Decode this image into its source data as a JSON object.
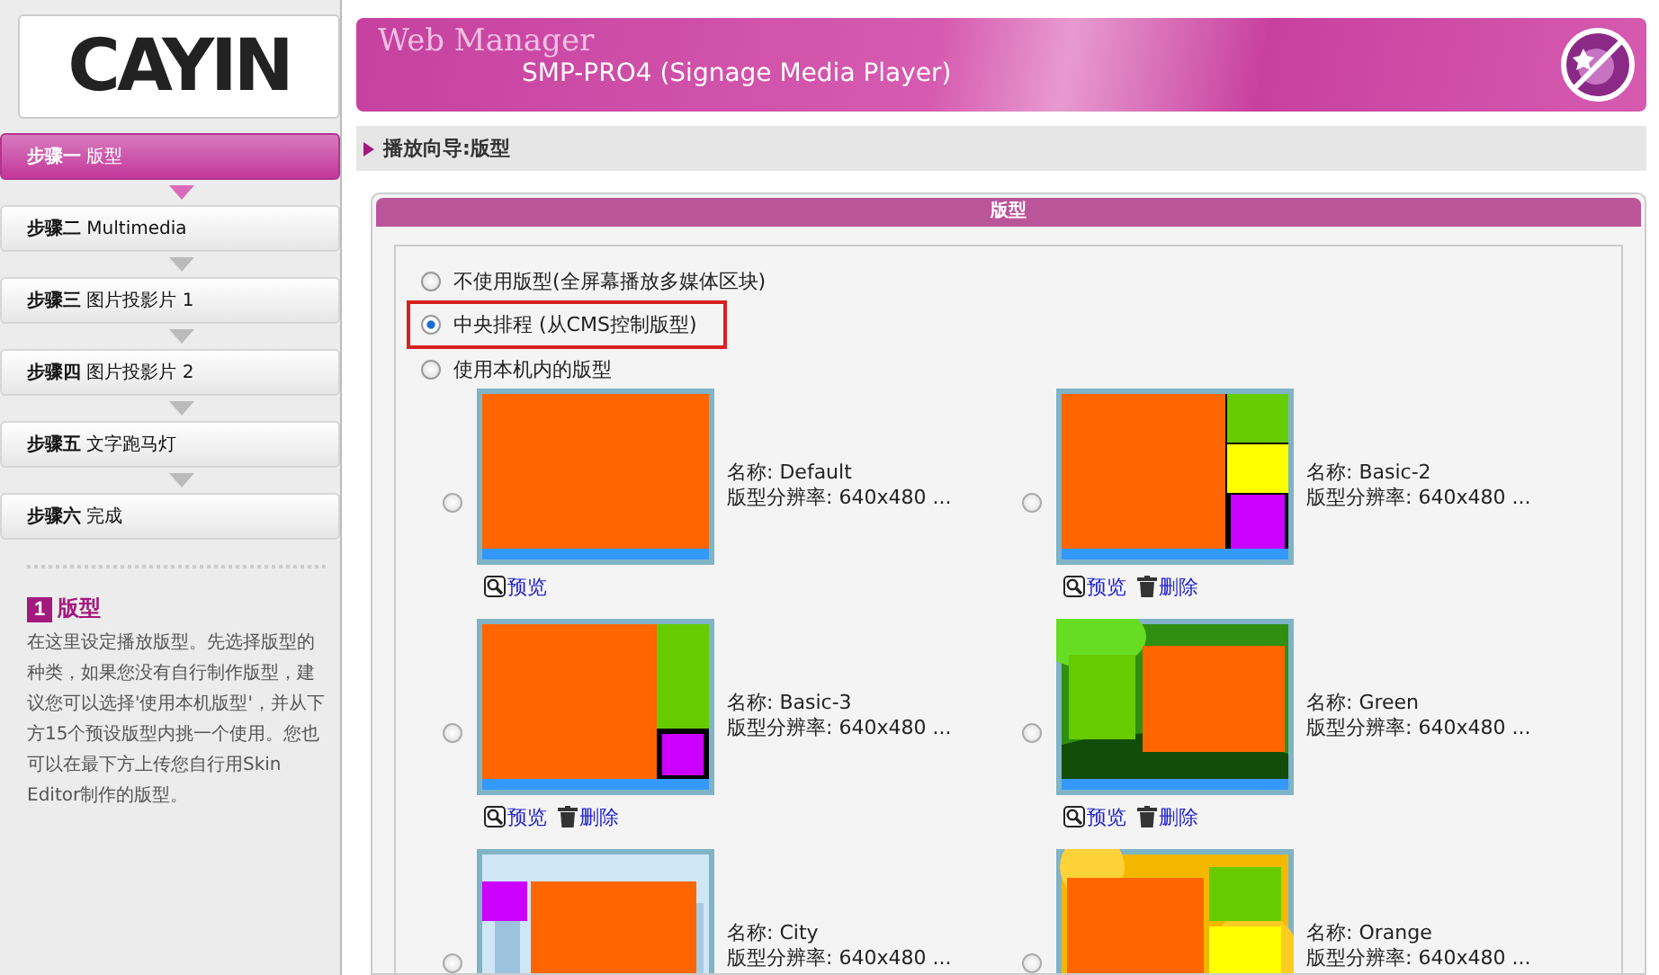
{
  "logo": "CAYIN",
  "header": {
    "title": "Web Manager",
    "subtitle": "SMP-PRO4 (Signage Media Player)"
  },
  "steps": [
    {
      "label": "**步骤一** 版型",
      "selected": true
    },
    {
      "label": "**步骤二** Multimedia",
      "selected": false
    },
    {
      "label": "**步骤三** 图片投影片 1",
      "selected": false
    },
    {
      "label": "**步骤四** 图片投影片 2",
      "selected": false
    },
    {
      "label": "**步骤五** 文字跑马灯",
      "selected": false
    },
    {
      "label": "**步骤六** 完成",
      "selected": false
    }
  ],
  "help": {
    "badge": "1",
    "title": "版型",
    "text": "在这里设定播放版型。先选择版型的种类，如果您没有自行制作版型，建议您可以选择'使用本机版型'，并从下方15个预设版型内挑一个使用。您也可以在最下方上传您自行用Skin Editor制作的版型。"
  },
  "breadcrumb": "播放向导:版型",
  "panel_title": "版型",
  "options": [
    {
      "label": "不使用版型(全屏幕播放多媒体区块)",
      "selected": false,
      "highlighted": false
    },
    {
      "label": "中央排程 (从CMS控制版型)",
      "selected": true,
      "highlighted": true
    },
    {
      "label": "使用本机内的版型",
      "selected": false,
      "highlighted": false
    }
  ],
  "layouts": [
    {
      "kind": "default",
      "name": "名称: Default",
      "resolution": "版型分辨率: 640x480 ...",
      "selected": false,
      "actions": [
        {
          "kind": "preview",
          "label": "预览"
        }
      ]
    },
    {
      "kind": "basic2",
      "name": "名称: Basic-2",
      "resolution": "版型分辨率: 640x480 ...",
      "selected": false,
      "actions": [
        {
          "kind": "preview",
          "label": "预览"
        },
        {
          "kind": "delete",
          "label": "删除"
        }
      ]
    },
    {
      "kind": "basic3",
      "name": "名称: Basic-3",
      "resolution": "版型分辨率: 640x480 ...",
      "selected": false,
      "actions": [
        {
          "kind": "preview",
          "label": "预览"
        },
        {
          "kind": "delete",
          "label": "删除"
        }
      ]
    },
    {
      "kind": "green",
      "name": "名称: Green",
      "resolution": "版型分辨率: 640x480 ...",
      "selected": false,
      "actions": [
        {
          "kind": "preview",
          "label": "预览"
        },
        {
          "kind": "delete",
          "label": "删除"
        }
      ]
    },
    {
      "kind": "city",
      "name": "名称: City",
      "resolution": "版型分辨率: 640x480 ...",
      "selected": false
    },
    {
      "kind": "orange",
      "name": "名称: Orange",
      "resolution": "版型分辨率: 640x480 ...",
      "selected": false
    }
  ]
}
